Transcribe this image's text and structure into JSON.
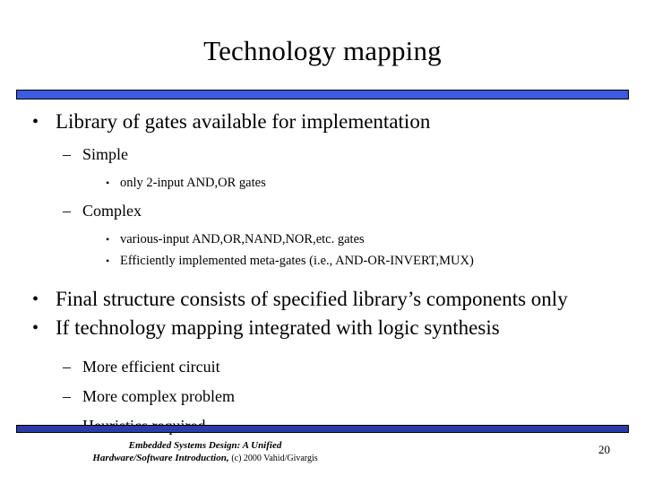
{
  "slide": {
    "title": "Technology mapping",
    "page_number": "20",
    "accent_color_top": "#3b5be0",
    "accent_color_bottom": "#2b3ba8",
    "text_color": "#000000",
    "background_color": "#ffffff"
  },
  "bullets": {
    "b1": {
      "marker": "•",
      "text": "Library of gates available for implementation"
    },
    "b1_s1": {
      "marker": "–",
      "text": "Simple"
    },
    "b1_s1_i1": {
      "marker": "•",
      "text": "only 2-input AND,OR gates"
    },
    "b1_s2": {
      "marker": "–",
      "text": "Complex"
    },
    "b1_s2_i1": {
      "marker": "•",
      "text": "various-input AND,OR,NAND,NOR,etc. gates"
    },
    "b1_s2_i2": {
      "marker": "•",
      "text": "Efficiently implemented meta-gates (i.e., AND-OR-INVERT,MUX)"
    },
    "b2": {
      "marker": "•",
      "text": "Final structure consists of specified library’s components only"
    },
    "b3": {
      "marker": "•",
      "text": "If technology mapping integrated with logic synthesis"
    },
    "b3_s1": {
      "marker": "–",
      "text": "More efficient circuit"
    },
    "b3_s2": {
      "marker": "–",
      "text": "More complex problem"
    },
    "b3_s3": {
      "marker": "–",
      "text": "Heuristics required"
    }
  },
  "footer": {
    "line1": "Embedded Systems Design: A Unified",
    "line2": "Hardware/Software Introduction,",
    "copyright": "(c) 2000 Vahid/Givargis"
  }
}
